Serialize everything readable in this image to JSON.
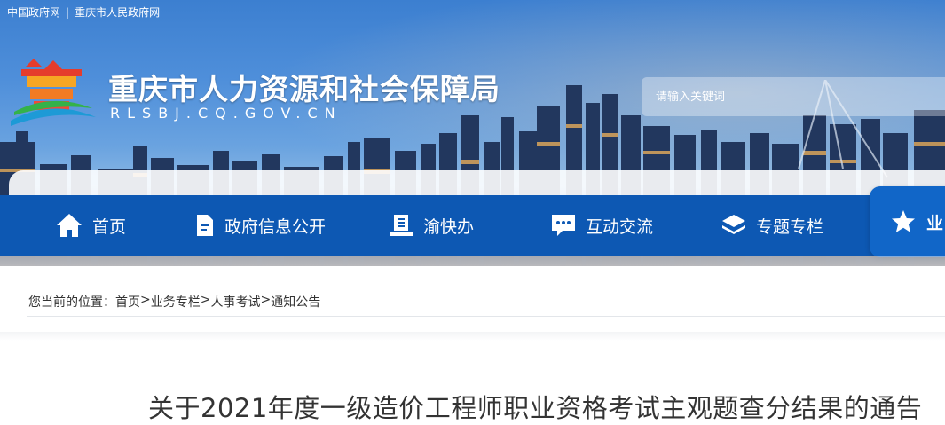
{
  "top_links": {
    "portal": "中国政府网",
    "separator": "|",
    "city": "重庆市人民政府网"
  },
  "header": {
    "title": "重庆市人力资源和社会保障局",
    "domain": "RLSBJ.CQ.GOV.CN"
  },
  "search": {
    "placeholder": "请输入关键词"
  },
  "nav": {
    "items": [
      {
        "label": "首页",
        "icon": "home-icon"
      },
      {
        "label": "政府信息公开",
        "icon": "document-icon"
      },
      {
        "label": "渝快办",
        "icon": "service-icon"
      },
      {
        "label": "互动交流",
        "icon": "chat-icon"
      },
      {
        "label": "专题专栏",
        "icon": "layers-icon"
      }
    ],
    "active": {
      "label": "业",
      "icon": "star-icon"
    }
  },
  "breadcrumb": {
    "prefix": "您当前的位置：",
    "items": [
      "首页",
      "业务专栏",
      "人事考试",
      "通知公告"
    ],
    "separator": ">"
  },
  "article": {
    "title": "关于2021年度一级造价工程师职业资格考试主观题查分结果的通告"
  },
  "colors": {
    "nav": "#0d58b3",
    "nav_active": "#1166c8",
    "text": "#333333"
  }
}
